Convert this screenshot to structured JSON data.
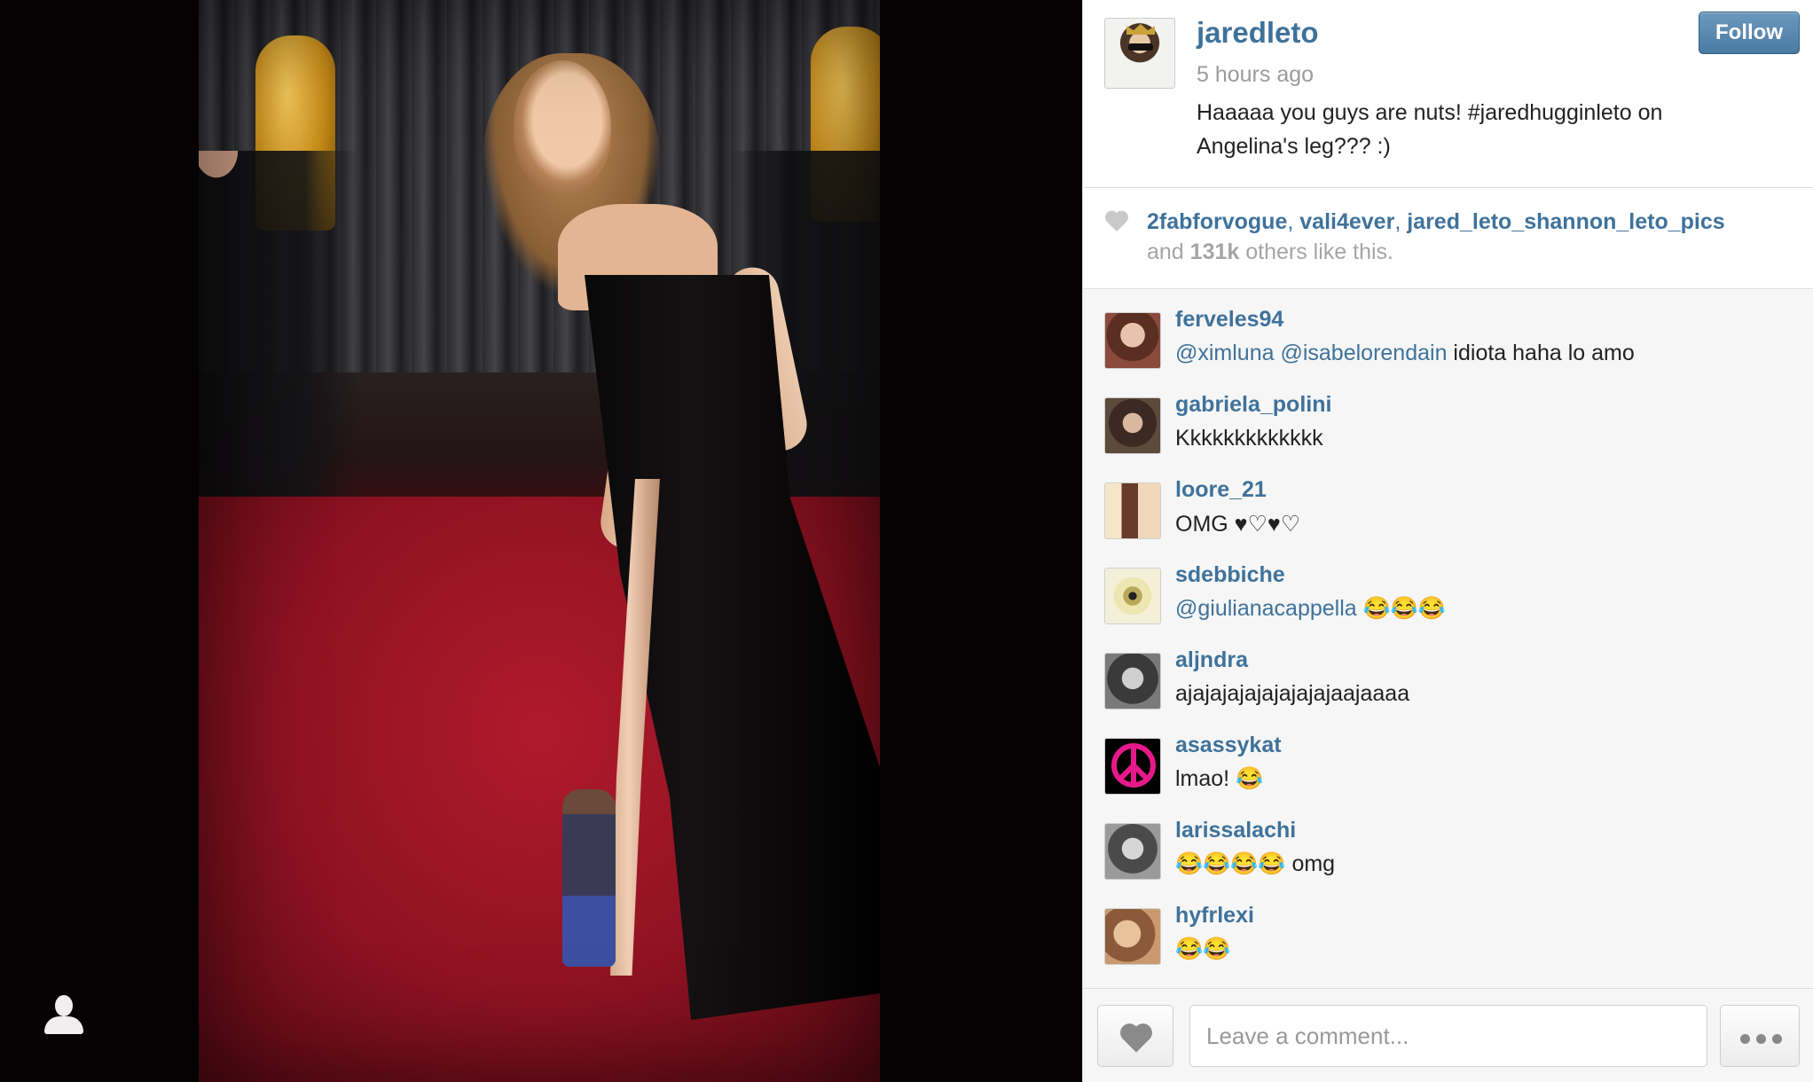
{
  "post": {
    "owner": "jaredleto",
    "time": "5 hours ago",
    "caption": "Haaaaa you guys are nuts! #jaredhugginleto on Angelina's leg??? :)",
    "follow_label": "Follow"
  },
  "likes": {
    "users": [
      "2fabforvogue",
      "vali4ever",
      "jared_leto_shannon_leto_pics"
    ],
    "separator": ", ",
    "prefix": "and ",
    "count": "131k",
    "suffix": " others like this."
  },
  "comments": [
    {
      "user": "ferveles94",
      "mentions": "@ximluna @isabelorendain",
      "text": " idiota haha lo amo"
    },
    {
      "user": "gabriela_polini",
      "mentions": "",
      "text": "Kkkkkkkkkkkkk"
    },
    {
      "user": "loore_21",
      "mentions": "",
      "text": "OMG ♥♡♥♡"
    },
    {
      "user": "sdebbiche",
      "mentions": "@giulianacappella",
      "text": " 😂😂😂"
    },
    {
      "user": "aljndra",
      "mentions": "",
      "text": "ajajajajajajajajajaajaaaa"
    },
    {
      "user": "asassykat",
      "mentions": "",
      "text": "lmao! 😂"
    },
    {
      "user": "larissalachi",
      "mentions": "",
      "text": "😂😂😂😂 omg"
    },
    {
      "user": "hyfrlexi",
      "mentions": "",
      "text": "😂😂"
    }
  ],
  "composer": {
    "placeholder": "Leave a comment..."
  },
  "colors": {
    "link": "#3f729b",
    "button_top": "#6c99bd",
    "button_bottom": "#4a7aa3"
  },
  "icons": {
    "like": "heart-icon",
    "more": "ellipsis-icon",
    "viewer": "user-silhouette-icon"
  }
}
